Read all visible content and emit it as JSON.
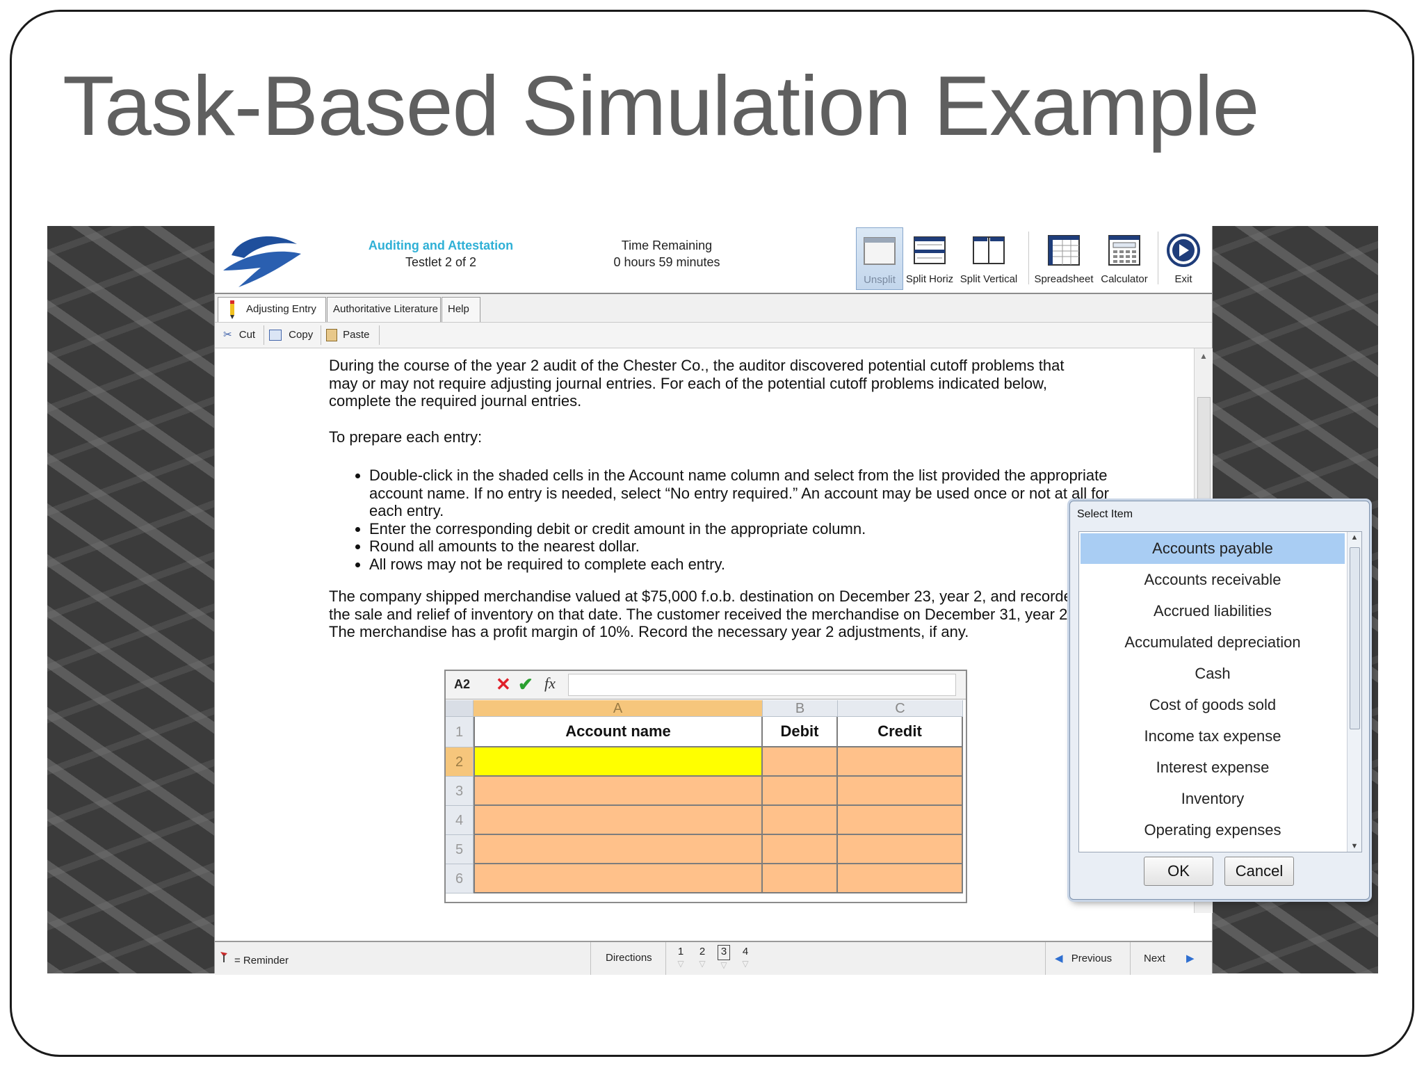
{
  "slide": {
    "title": "Task-Based Simulation Example"
  },
  "header": {
    "exam_title": "Auditing and Attestation",
    "exam_subtitle": "Testlet 2 of 2",
    "time_label": "Time Remaining",
    "time_value": "0 hours 59 minutes"
  },
  "toolbar": [
    {
      "label": "Unsplit",
      "icon": "unsplit-icon",
      "selected": true
    },
    {
      "label": "Split Horiz",
      "icon": "split-horizontal-icon"
    },
    {
      "label": "Split Vertical",
      "icon": "split-vertical-icon"
    },
    {
      "label": "Spreadsheet",
      "icon": "spreadsheet-icon"
    },
    {
      "label": "Calculator",
      "icon": "calculator-icon"
    },
    {
      "label": "Exit",
      "icon": "exit-arrow-icon"
    }
  ],
  "tabs": [
    "Adjusting Entry",
    "Authoritative Literature",
    "Help"
  ],
  "edit": {
    "cut": "Cut",
    "copy": "Copy",
    "paste": "Paste"
  },
  "content": {
    "intro": "During the course of the year 2 audit of the Chester Co., the auditor discovered potential cutoff problems that may or may not require adjusting journal entries. For each of the potential cutoff problems indicated below, complete the required journal entries.",
    "prepare": "To prepare each entry:",
    "bullets": [
      "Double-click in the shaded cells in the Account name column and select from the list provided the appropriate account name. If no entry is needed, select “No entry required.” An account may be used once or not at all for each entry.",
      "Enter the corresponding debit or credit amount in the appropriate column.",
      "Round all amounts to the nearest dollar.",
      "All rows may not be required to complete each entry."
    ],
    "scenario": "The company shipped merchandise valued at $75,000 f.o.b. destination on December 23, year 2, and recorded the sale and relief of inventory on that date. The customer received the merchandise on December 31, year 2. The merchandise has a profit margin of 10%. Record the necessary year 2 adjustments, if any."
  },
  "sheet": {
    "cell_ref": "A2",
    "fx": "fx",
    "columns": [
      "A",
      "B",
      "C"
    ],
    "rows": [
      "1",
      "2",
      "3",
      "4",
      "5",
      "6"
    ],
    "headers": [
      "Account name",
      "Debit",
      "Credit"
    ]
  },
  "dialog": {
    "title": "Select Item",
    "options": [
      "Accounts payable",
      "Accounts receivable",
      "Accrued liabilities",
      "Accumulated depreciation",
      "Cash",
      "Cost of goods sold",
      "Income tax expense",
      "Interest expense",
      "Inventory",
      "Operating expenses"
    ],
    "selected_index": 0,
    "ok": "OK",
    "cancel": "Cancel"
  },
  "footer": {
    "reminder": "= Reminder",
    "directions": "Directions",
    "pages": [
      "1",
      "2",
      "3",
      "4"
    ],
    "current_page": "3",
    "previous": "Previous",
    "next": "Next"
  },
  "colors": {
    "accent": "#2fb0d6",
    "shaded_cell": "#ffc18a",
    "active_cell": "#ffff00",
    "selection": "#a9cdf3"
  }
}
